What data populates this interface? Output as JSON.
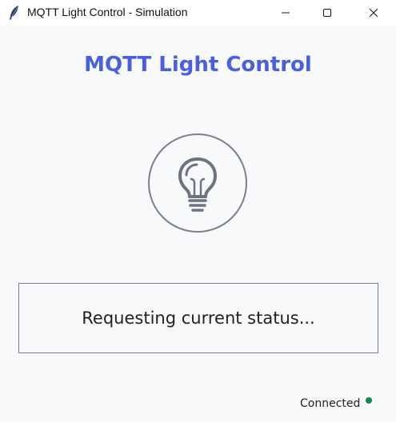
{
  "window": {
    "title": "MQTT Light Control - Simulation",
    "app_icon": "feather-icon",
    "controls": [
      "minimize-icon",
      "maximize-icon",
      "close-icon"
    ]
  },
  "main": {
    "heading": "MQTT Light Control",
    "bulb_icon": "lightbulb-icon",
    "status_message": "Requesting current status..."
  },
  "connection": {
    "label": "Connected",
    "indicator_color": "#0a8a4e"
  },
  "colors": {
    "accent": "#4a5fe0",
    "background": "#f8f9fb",
    "outline": "#7d8085"
  }
}
